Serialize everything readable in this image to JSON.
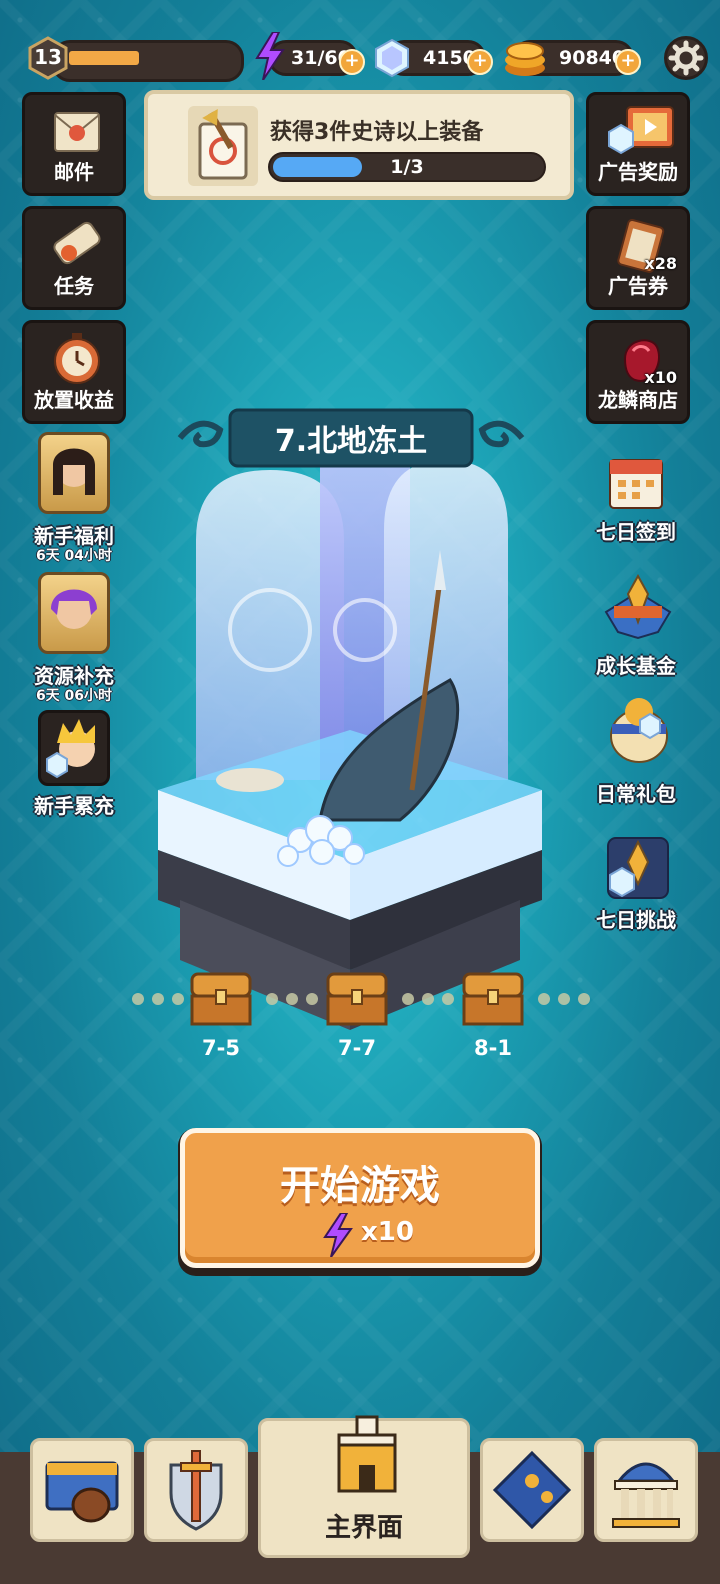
{
  "player": {
    "level": "13",
    "xp_fraction": 0.45
  },
  "resources": {
    "energy": "31/60",
    "gems": "4150",
    "gold": "90840"
  },
  "quest": {
    "title": "获得3件史诗以上装备",
    "progress_text": "1/3",
    "progress_fraction": 0.333
  },
  "left_menu": [
    {
      "label": "邮件",
      "icon": "mail-icon"
    },
    {
      "label": "任务",
      "icon": "scroll-icon"
    },
    {
      "label": "放置收益",
      "icon": "stopwatch-icon"
    }
  ],
  "right_menu": [
    {
      "label": "广告奖励",
      "icon": "tv-ad-icon"
    },
    {
      "label": "广告券",
      "icon": "ad-ticket-icon",
      "qty": "x28"
    },
    {
      "label": "龙鳞商店",
      "icon": "dragon-scale-icon",
      "qty": "x10"
    }
  ],
  "left_events": [
    {
      "label": "新手福利",
      "timer": "6天 04小时"
    },
    {
      "label": "资源补充",
      "timer": "6天 06小时"
    },
    {
      "label": "新手累充",
      "timer": ""
    }
  ],
  "right_events": [
    {
      "label": "七日签到"
    },
    {
      "label": "成长基金"
    },
    {
      "label": "日常礼包"
    },
    {
      "label": "七日挑战"
    }
  ],
  "stage": {
    "name": "7.北地冻土"
  },
  "chests": [
    {
      "label": "7-5"
    },
    {
      "label": "7-7"
    },
    {
      "label": "8-1"
    }
  ],
  "start_button": {
    "label": "开始游戏",
    "cost": "x10"
  },
  "bottom_nav": [
    {
      "label": "",
      "icon": "shop-icon"
    },
    {
      "label": "",
      "icon": "sword-shield-icon"
    },
    {
      "label": "主界面",
      "icon": "castle-icon",
      "active": true
    },
    {
      "label": "",
      "icon": "map-icon"
    },
    {
      "label": "",
      "icon": "temple-icon"
    }
  ],
  "colors": {
    "accent_orange": "#f0a14b",
    "bar_blue": "#56a9f5",
    "energy_purple": "#b04cff"
  }
}
